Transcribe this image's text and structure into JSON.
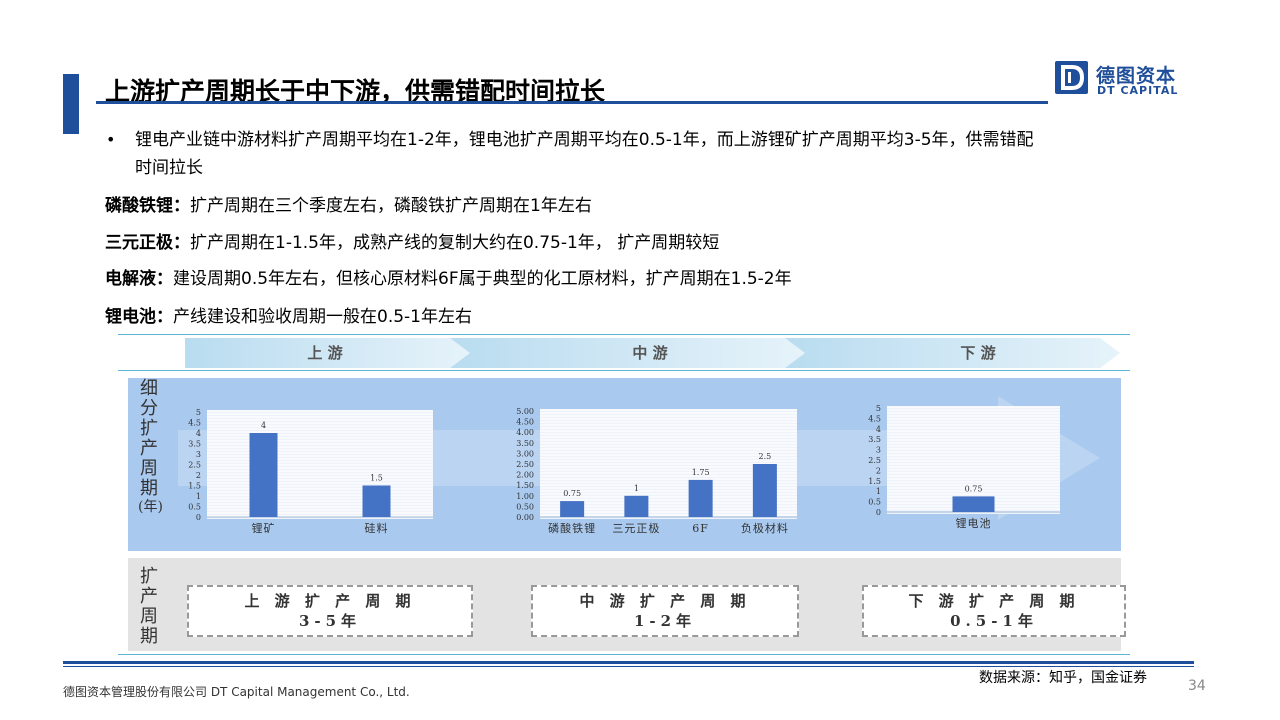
{
  "title": "上游扩产周期长于中下游，供需错配时间拉长",
  "logo": {
    "cn": "德图资本",
    "en": "DT CAPITAL"
  },
  "bullet": {
    "symbol": "•",
    "line1": "锂电产业链中游材料扩产周期平均在1-2年，锂电池扩产周期平均在0.5-1年，而上游锂矿扩产周期平均3-5年，供需错配",
    "line2": "时间拉长"
  },
  "points": [
    {
      "label": "磷酸铁锂：",
      "text": "扩产周期在三个季度左右，磷酸铁扩产周期在1年左右"
    },
    {
      "label": "三元正极：",
      "text": "扩产周期在1-1.5年，成熟产线的复制大约在0.75-1年， 扩产周期较短"
    },
    {
      "label": "电解液：",
      "text": "建设周期0.5年左右，但核心原材料6F属于典型的化工原材料，扩产周期在1.5-2年"
    },
    {
      "label": "锂电池：",
      "text": "产线建设和验收周期一般在0.5-1年左右"
    }
  ],
  "stages": [
    "上 游",
    "中 游",
    "下 游"
  ],
  "row_label_top": [
    "细",
    "分",
    "扩",
    "产",
    "周",
    "期",
    "(年)"
  ],
  "row_label_bottom": [
    "扩",
    "产",
    "周",
    "期"
  ],
  "cycles": [
    {
      "line1": "上 游 扩 产 周 期",
      "line2": "3-5年"
    },
    {
      "line1": "中 游 扩 产 周 期",
      "line2": "1-2年"
    },
    {
      "line1": "下 游 扩 产 周 期",
      "line2": "0.5-1年"
    }
  ],
  "colors": {
    "accent": "#1f4e9a",
    "bar": "#4472c4",
    "panel": "#a9c9ef"
  },
  "chart_data": [
    {
      "type": "bar",
      "categories": [
        "锂矿",
        "硅料"
      ],
      "values": [
        4,
        1.5
      ],
      "data_labels": [
        "4",
        "1.5"
      ],
      "yticks": [
        "0",
        "0.5",
        "1",
        "1.5",
        "2",
        "2.5",
        "3",
        "3.5",
        "4",
        "4.5",
        "5"
      ],
      "ylim": [
        0,
        5
      ]
    },
    {
      "type": "bar",
      "categories": [
        "磷酸铁锂",
        "三元正极",
        "6F",
        "负极材料"
      ],
      "values": [
        0.75,
        1,
        1.75,
        2.5
      ],
      "data_labels": [
        "0.75",
        "1",
        "1.75",
        "2.5"
      ],
      "yticks": [
        "0.00",
        "0.50",
        "1.00",
        "1.50",
        "2.00",
        "2.50",
        "3.00",
        "3.50",
        "4.00",
        "4.50",
        "5.00"
      ],
      "ylim": [
        0,
        5
      ]
    },
    {
      "type": "bar",
      "categories": [
        "锂电池"
      ],
      "values": [
        0.75
      ],
      "data_labels": [
        "0.75"
      ],
      "yticks": [
        "0",
        "0.5",
        "1",
        "1.5",
        "2",
        "2.5",
        "3",
        "3.5",
        "4",
        "4.5",
        "5"
      ],
      "ylim": [
        0,
        5
      ]
    }
  ],
  "source": "数据来源：知乎，国金证券",
  "company": "德图资本管理股份有限公司 DT Capital Management Co., Ltd.",
  "page": "34"
}
